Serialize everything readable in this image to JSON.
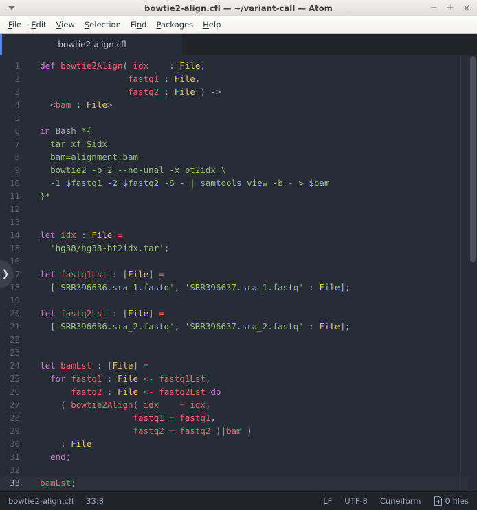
{
  "window": {
    "title": "bowtie2-align.cfl — ~/variant-call — Atom",
    "menu_arrow_icon": "chevron-down-icon",
    "minimize_label": "−",
    "maximize_label": "+",
    "close_label": "✕"
  },
  "menubar": {
    "items": [
      {
        "pre": "",
        "acc": "F",
        "post": "ile"
      },
      {
        "pre": "",
        "acc": "E",
        "post": "dit"
      },
      {
        "pre": "",
        "acc": "V",
        "post": "iew"
      },
      {
        "pre": "",
        "acc": "S",
        "post": "election"
      },
      {
        "pre": "Fi",
        "acc": "n",
        "post": "d"
      },
      {
        "pre": "",
        "acc": "P",
        "post": "ackages"
      },
      {
        "pre": "",
        "acc": "H",
        "post": "elp"
      }
    ]
  },
  "tabs": [
    {
      "label": "bowtie2-align.cfl",
      "active": true
    }
  ],
  "tree_toggle": {
    "icon": "chevron-right-icon",
    "glyph": "❯"
  },
  "editor": {
    "active_line": 33,
    "total_lines": 33,
    "lines": [
      {
        "n": 1,
        "tokens": [
          {
            "t": "plain",
            "v": "  "
          },
          {
            "t": "kw",
            "v": "def"
          },
          {
            "t": "plain",
            "v": " "
          },
          {
            "t": "ident",
            "v": "bowtie2Align"
          },
          {
            "t": "punct",
            "v": "( "
          },
          {
            "t": "ident",
            "v": "idx"
          },
          {
            "t": "plain",
            "v": "    "
          },
          {
            "t": "punct",
            "v": ": "
          },
          {
            "t": "type",
            "v": "File"
          },
          {
            "t": "punct",
            "v": ","
          }
        ]
      },
      {
        "n": 2,
        "tokens": [
          {
            "t": "plain",
            "v": "                   "
          },
          {
            "t": "ident",
            "v": "fastq1"
          },
          {
            "t": "punct",
            "v": " : "
          },
          {
            "t": "type",
            "v": "File"
          },
          {
            "t": "punct",
            "v": ","
          }
        ]
      },
      {
        "n": 3,
        "tokens": [
          {
            "t": "plain",
            "v": "                   "
          },
          {
            "t": "ident",
            "v": "fastq2"
          },
          {
            "t": "punct",
            "v": " : "
          },
          {
            "t": "type",
            "v": "File"
          },
          {
            "t": "punct",
            "v": " ) "
          },
          {
            "t": "punct",
            "v": "->"
          }
        ]
      },
      {
        "n": 4,
        "tokens": [
          {
            "t": "plain",
            "v": "    "
          },
          {
            "t": "punct",
            "v": "<"
          },
          {
            "t": "ident",
            "v": "bam"
          },
          {
            "t": "punct",
            "v": " : "
          },
          {
            "t": "type",
            "v": "File"
          },
          {
            "t": "punct",
            "v": ">"
          }
        ]
      },
      {
        "n": 5,
        "tokens": []
      },
      {
        "n": 6,
        "tokens": [
          {
            "t": "plain",
            "v": "  "
          },
          {
            "t": "kw",
            "v": "in"
          },
          {
            "t": "plain",
            "v": " "
          },
          {
            "t": "plain",
            "v": "Bash"
          },
          {
            "t": "bash",
            "v": " *{"
          }
        ]
      },
      {
        "n": 7,
        "tokens": [
          {
            "t": "bash",
            "v": "    tar xf $idx"
          }
        ]
      },
      {
        "n": 8,
        "tokens": [
          {
            "t": "bash",
            "v": "    bam=alignment.bam"
          }
        ]
      },
      {
        "n": 9,
        "tokens": [
          {
            "t": "bash",
            "v": "    bowtie2 -p 2 --no-unal -x bt2idx \\"
          }
        ]
      },
      {
        "n": 10,
        "tokens": [
          {
            "t": "bash",
            "v": "    -1 $fastq1 -2 $fastq2 -S - | samtools view -b - > $bam"
          }
        ]
      },
      {
        "n": 11,
        "tokens": [
          {
            "t": "bash",
            "v": "  }*"
          }
        ]
      },
      {
        "n": 12,
        "tokens": []
      },
      {
        "n": 13,
        "tokens": []
      },
      {
        "n": 14,
        "tokens": [
          {
            "t": "plain",
            "v": "  "
          },
          {
            "t": "kw",
            "v": "let"
          },
          {
            "t": "plain",
            "v": " "
          },
          {
            "t": "ident",
            "v": "idx"
          },
          {
            "t": "punct",
            "v": " : "
          },
          {
            "t": "type",
            "v": "File"
          },
          {
            "t": "plain",
            "v": " "
          },
          {
            "t": "ident",
            "v": "="
          }
        ]
      },
      {
        "n": 15,
        "tokens": [
          {
            "t": "plain",
            "v": "    "
          },
          {
            "t": "str",
            "v": "'hg38/hg38-bt2idx.tar'"
          },
          {
            "t": "punct",
            "v": ";"
          }
        ]
      },
      {
        "n": 16,
        "tokens": []
      },
      {
        "n": 17,
        "tokens": [
          {
            "t": "plain",
            "v": "  "
          },
          {
            "t": "kw",
            "v": "let"
          },
          {
            "t": "plain",
            "v": " "
          },
          {
            "t": "ident",
            "v": "fastq1Lst"
          },
          {
            "t": "punct",
            "v": " : ["
          },
          {
            "t": "type",
            "v": "File"
          },
          {
            "t": "punct",
            "v": "] "
          },
          {
            "t": "ident",
            "v": "="
          }
        ]
      },
      {
        "n": 18,
        "tokens": [
          {
            "t": "plain",
            "v": "    ["
          },
          {
            "t": "str",
            "v": "'SRR396636.sra_1.fastq'"
          },
          {
            "t": "punct",
            "v": ", "
          },
          {
            "t": "str",
            "v": "'SRR396637.sra_1.fastq'"
          },
          {
            "t": "punct",
            "v": " : "
          },
          {
            "t": "type",
            "v": "File"
          },
          {
            "t": "punct",
            "v": "];"
          }
        ]
      },
      {
        "n": 19,
        "tokens": []
      },
      {
        "n": 20,
        "tokens": [
          {
            "t": "plain",
            "v": "  "
          },
          {
            "t": "kw",
            "v": "let"
          },
          {
            "t": "plain",
            "v": " "
          },
          {
            "t": "ident",
            "v": "fastq2Lst"
          },
          {
            "t": "punct",
            "v": " : ["
          },
          {
            "t": "type",
            "v": "File"
          },
          {
            "t": "punct",
            "v": "] "
          },
          {
            "t": "ident",
            "v": "="
          }
        ]
      },
      {
        "n": 21,
        "tokens": [
          {
            "t": "plain",
            "v": "    ["
          },
          {
            "t": "str",
            "v": "'SRR396636.sra_2.fastq'"
          },
          {
            "t": "punct",
            "v": ", "
          },
          {
            "t": "str",
            "v": "'SRR396637.sra_2.fastq'"
          },
          {
            "t": "punct",
            "v": " : "
          },
          {
            "t": "type",
            "v": "File"
          },
          {
            "t": "punct",
            "v": "];"
          }
        ]
      },
      {
        "n": 22,
        "tokens": []
      },
      {
        "n": 23,
        "tokens": []
      },
      {
        "n": 24,
        "tokens": [
          {
            "t": "plain",
            "v": "  "
          },
          {
            "t": "kw",
            "v": "let"
          },
          {
            "t": "plain",
            "v": " "
          },
          {
            "t": "ident",
            "v": "bamLst"
          },
          {
            "t": "punct",
            "v": " : ["
          },
          {
            "t": "type",
            "v": "File"
          },
          {
            "t": "punct",
            "v": "] "
          },
          {
            "t": "ident",
            "v": "="
          }
        ]
      },
      {
        "n": 25,
        "tokens": [
          {
            "t": "plain",
            "v": "    "
          },
          {
            "t": "kw",
            "v": "for"
          },
          {
            "t": "plain",
            "v": " "
          },
          {
            "t": "ident",
            "v": "fastq1"
          },
          {
            "t": "punct",
            "v": " : "
          },
          {
            "t": "type",
            "v": "File"
          },
          {
            "t": "plain",
            "v": " "
          },
          {
            "t": "ident",
            "v": "<-"
          },
          {
            "t": "plain",
            "v": " "
          },
          {
            "t": "ident",
            "v": "fastq1Lst"
          },
          {
            "t": "punct",
            "v": ","
          }
        ]
      },
      {
        "n": 26,
        "tokens": [
          {
            "t": "plain",
            "v": "        "
          },
          {
            "t": "ident",
            "v": "fastq2"
          },
          {
            "t": "punct",
            "v": " : "
          },
          {
            "t": "type",
            "v": "File"
          },
          {
            "t": "plain",
            "v": " "
          },
          {
            "t": "ident",
            "v": "<-"
          },
          {
            "t": "plain",
            "v": " "
          },
          {
            "t": "ident",
            "v": "fastq2Lst"
          },
          {
            "t": "plain",
            "v": " "
          },
          {
            "t": "kw",
            "v": "do"
          }
        ]
      },
      {
        "n": 27,
        "tokens": [
          {
            "t": "plain",
            "v": "      "
          },
          {
            "t": "punct",
            "v": "( "
          },
          {
            "t": "ident",
            "v": "bowtie2Align"
          },
          {
            "t": "punct",
            "v": "( "
          },
          {
            "t": "ident",
            "v": "idx"
          },
          {
            "t": "plain",
            "v": "    "
          },
          {
            "t": "ident",
            "v": "="
          },
          {
            "t": "plain",
            "v": " "
          },
          {
            "t": "ident",
            "v": "idx"
          },
          {
            "t": "punct",
            "v": ","
          }
        ]
      },
      {
        "n": 28,
        "tokens": [
          {
            "t": "plain",
            "v": "                    "
          },
          {
            "t": "ident",
            "v": "fastq1"
          },
          {
            "t": "plain",
            "v": " "
          },
          {
            "t": "ident",
            "v": "="
          },
          {
            "t": "plain",
            "v": " "
          },
          {
            "t": "ident",
            "v": "fastq1"
          },
          {
            "t": "punct",
            "v": ","
          }
        ]
      },
      {
        "n": 29,
        "tokens": [
          {
            "t": "plain",
            "v": "                    "
          },
          {
            "t": "ident",
            "v": "fastq2"
          },
          {
            "t": "plain",
            "v": " "
          },
          {
            "t": "ident",
            "v": "="
          },
          {
            "t": "plain",
            "v": " "
          },
          {
            "t": "ident",
            "v": "fastq2"
          },
          {
            "t": "punct",
            "v": " )|"
          },
          {
            "t": "ident",
            "v": "bam"
          },
          {
            "t": "punct",
            "v": " )"
          }
        ]
      },
      {
        "n": 30,
        "tokens": [
          {
            "t": "plain",
            "v": "      "
          },
          {
            "t": "punct",
            "v": ": "
          },
          {
            "t": "type",
            "v": "File"
          }
        ]
      },
      {
        "n": 31,
        "tokens": [
          {
            "t": "plain",
            "v": "    "
          },
          {
            "t": "kw",
            "v": "end"
          },
          {
            "t": "punct",
            "v": ";"
          }
        ]
      },
      {
        "n": 32,
        "tokens": []
      },
      {
        "n": 33,
        "tokens": [
          {
            "t": "plain",
            "v": "  "
          },
          {
            "t": "ident",
            "v": "bamLst"
          },
          {
            "t": "punct",
            "v": ";"
          }
        ]
      }
    ]
  },
  "statusbar": {
    "filename": "bowtie2-align.cfl",
    "cursor": "33:8",
    "line_ending": "LF",
    "encoding": "UTF-8",
    "grammar": "Cuneiform",
    "git_icon": "diff-added-icon",
    "git_files": "0 files"
  },
  "colors": {
    "accent": "#528bff",
    "editor_bg": "#282c34",
    "chrome_bg": "#21252b",
    "keyword": "#c678dd",
    "identifier": "#e06c75",
    "type": "#e5c07b",
    "string": "#98c379",
    "punctuation": "#abb2bf"
  }
}
